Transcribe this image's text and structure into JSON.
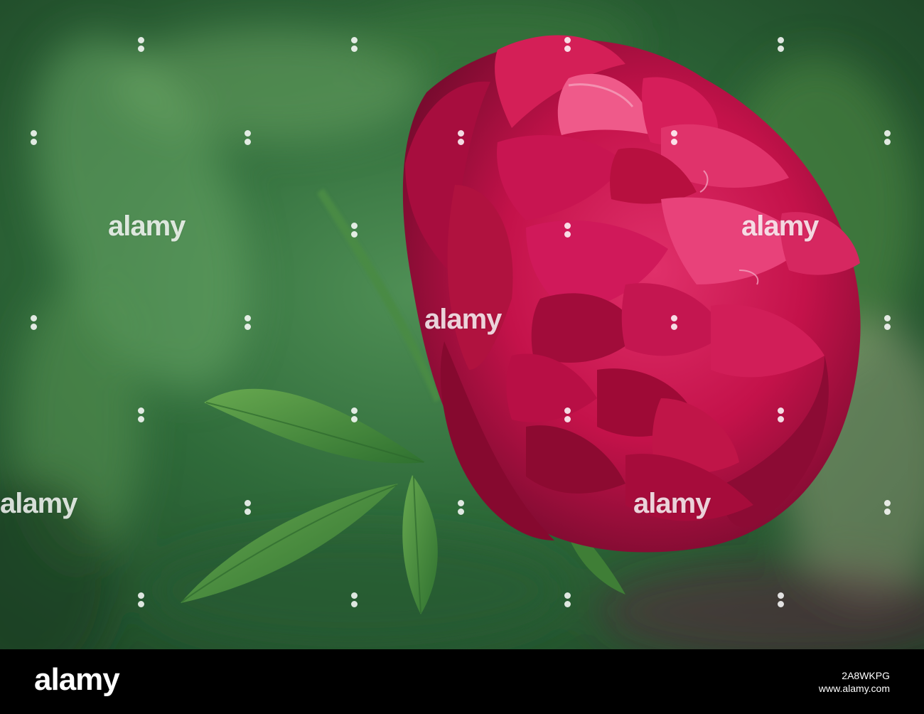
{
  "photo": {
    "subject": "peony-flower-icon",
    "colors": {
      "petal": "#c4124a",
      "petal_dark": "#6e0a2a",
      "petal_light": "#e23c72",
      "leaf": "#3f8a3a",
      "background": "#2f6b3a"
    }
  },
  "watermarks": {
    "brand": "alamy"
  },
  "footer": {
    "logo": "alamy",
    "image_id": "2A8WKPG",
    "url": "www.alamy.com"
  }
}
